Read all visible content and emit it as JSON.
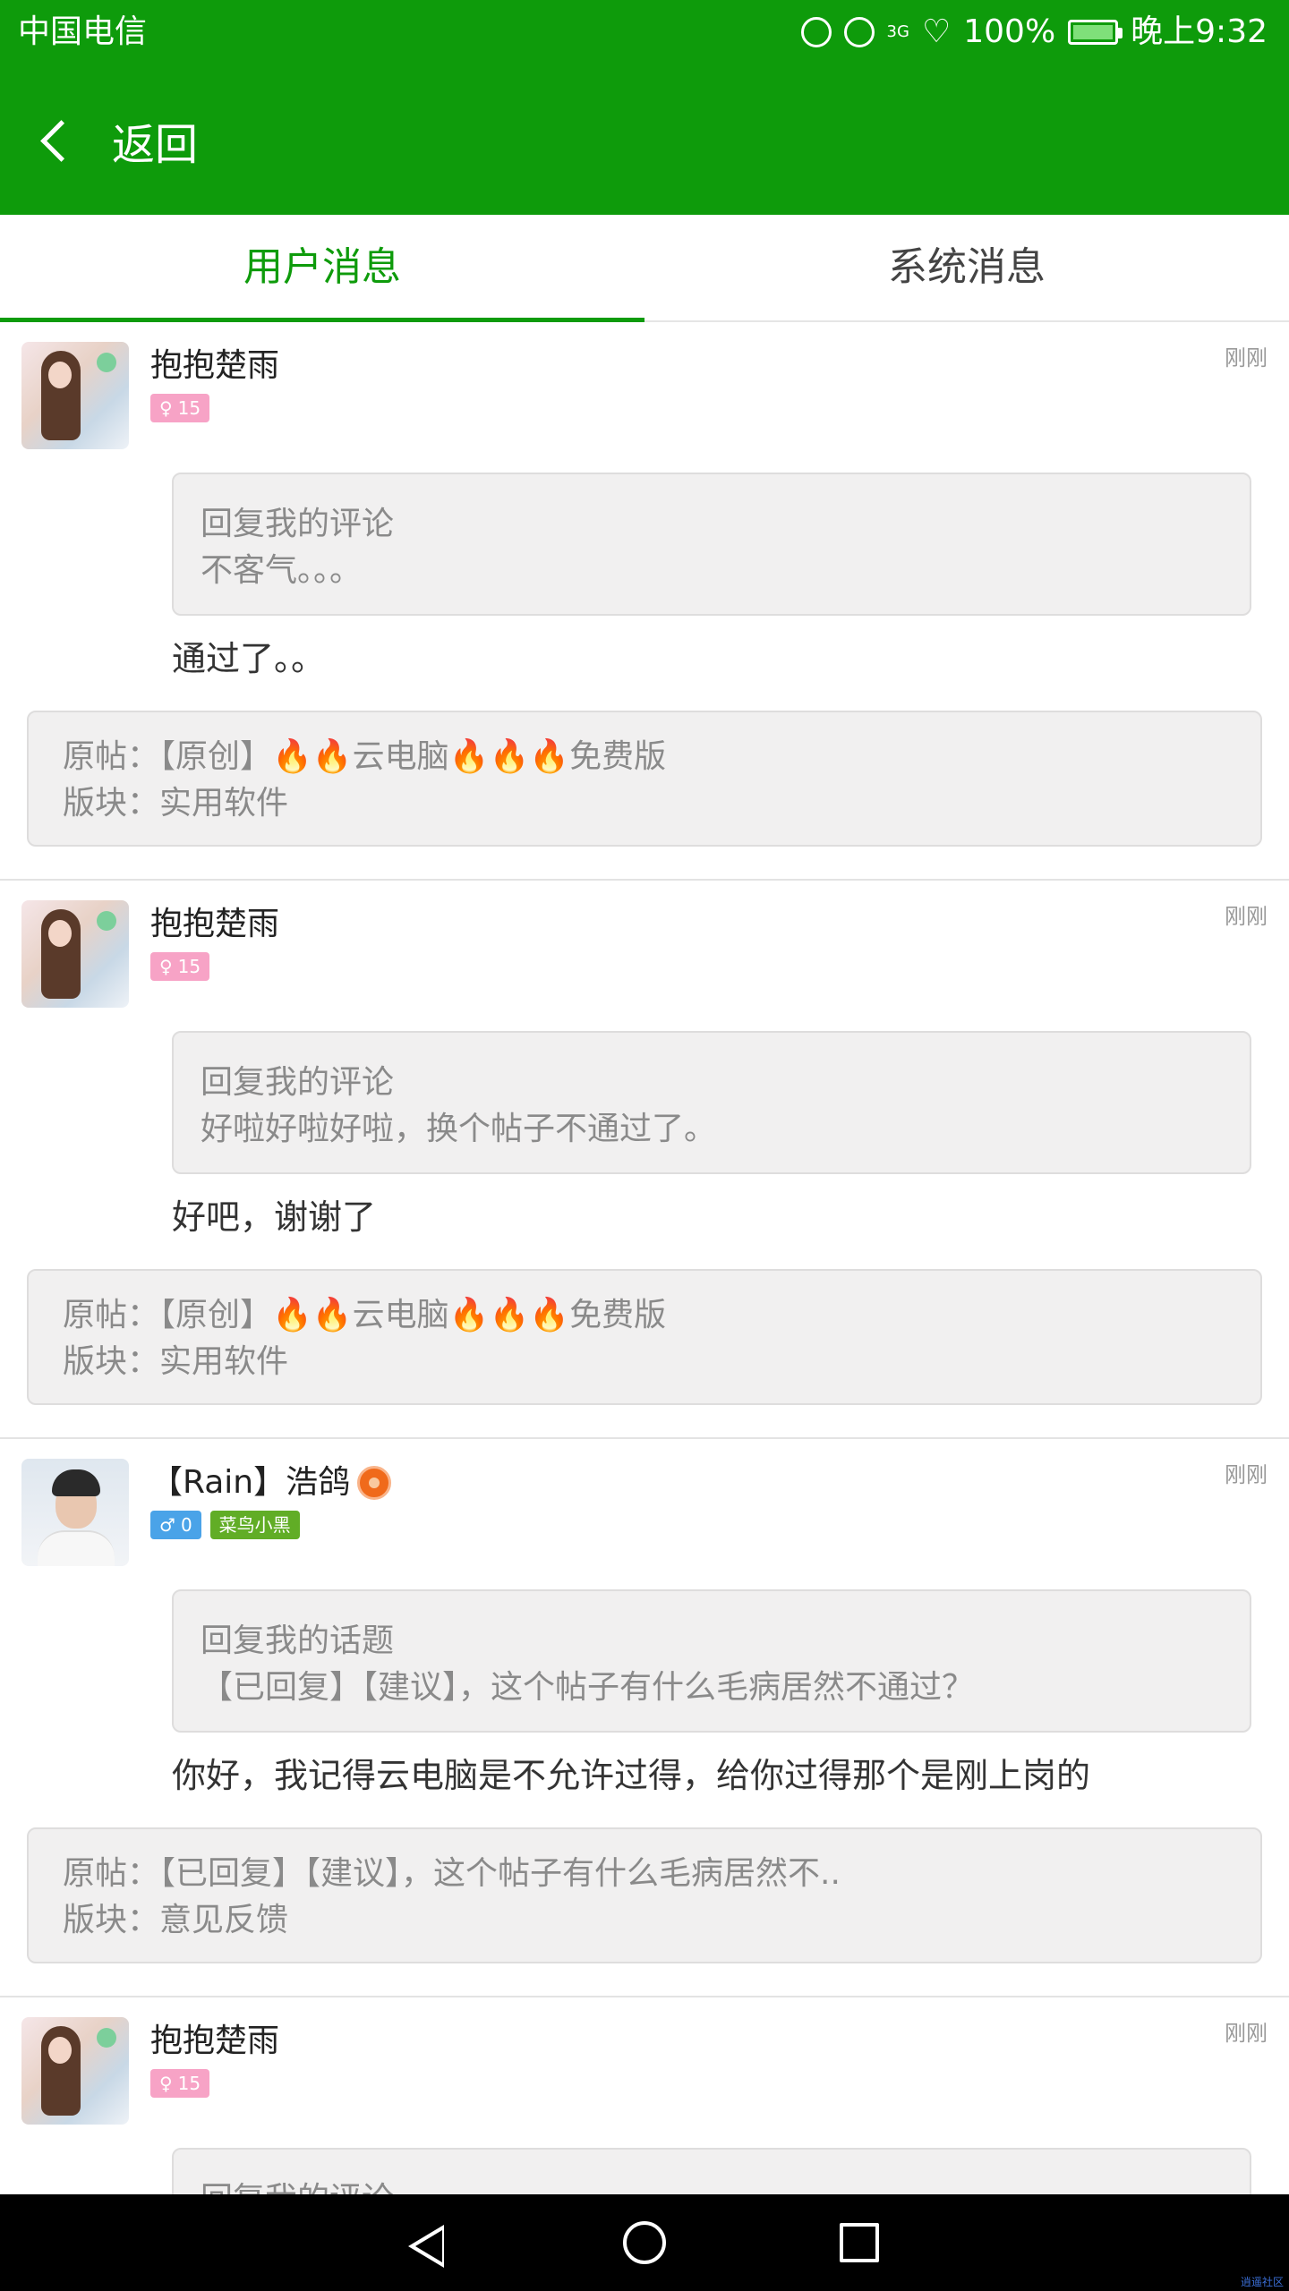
{
  "status_bar": {
    "carrier": "中国电信",
    "network": "3G",
    "battery": "100%",
    "time": "晚上9:32"
  },
  "app_bar": {
    "back_label": "返回"
  },
  "tabs": [
    {
      "label": "用户消息",
      "active": true
    },
    {
      "label": "系统消息",
      "active": false
    }
  ],
  "messages": [
    {
      "username": "抱抱楚雨",
      "gender_badge": "15",
      "time": "刚刚",
      "quote_title": "回复我的评论",
      "quote_text": "不客气。。。",
      "reply": "通过了。。",
      "origin_post": "原帖：【原创】🔥🔥云电脑🔥🔥🔥免费版",
      "origin_board": "版块：实用软件"
    },
    {
      "username": "抱抱楚雨",
      "gender_badge": "15",
      "time": "刚刚",
      "quote_title": "回复我的评论",
      "quote_text": "好啦好啦好啦，换个帖子不通过了。",
      "reply": "好吧，谢谢了",
      "origin_post": "原帖：【原创】🔥🔥云电脑🔥🔥🔥免费版",
      "origin_board": "版块：实用软件"
    },
    {
      "username": "【Rain】浩鸽",
      "gender_badge": "0",
      "title_badge": "菜鸟小黑",
      "time": "刚刚",
      "quote_title": "回复我的话题",
      "quote_text": "【已回复】【建议】，这个帖子有什么毛病居然不通过？",
      "reply": "你好，我记得云电脑是不允许过得，给你过得那个是刚上岗的",
      "origin_post": "原帖：【已回复】【建议】，这个帖子有什么毛病居然不..",
      "origin_board": "版块：意见反馈"
    },
    {
      "username": "抱抱楚雨",
      "gender_badge": "15",
      "time": "刚刚",
      "quote_title": "回复我的评论"
    }
  ],
  "watermark": "逍遥社区",
  "colors": {
    "brand_green": "#0e9b0b",
    "badge_female": "#f7a3c6",
    "badge_male": "#4aa3e8",
    "badge_title": "#61ad26"
  }
}
